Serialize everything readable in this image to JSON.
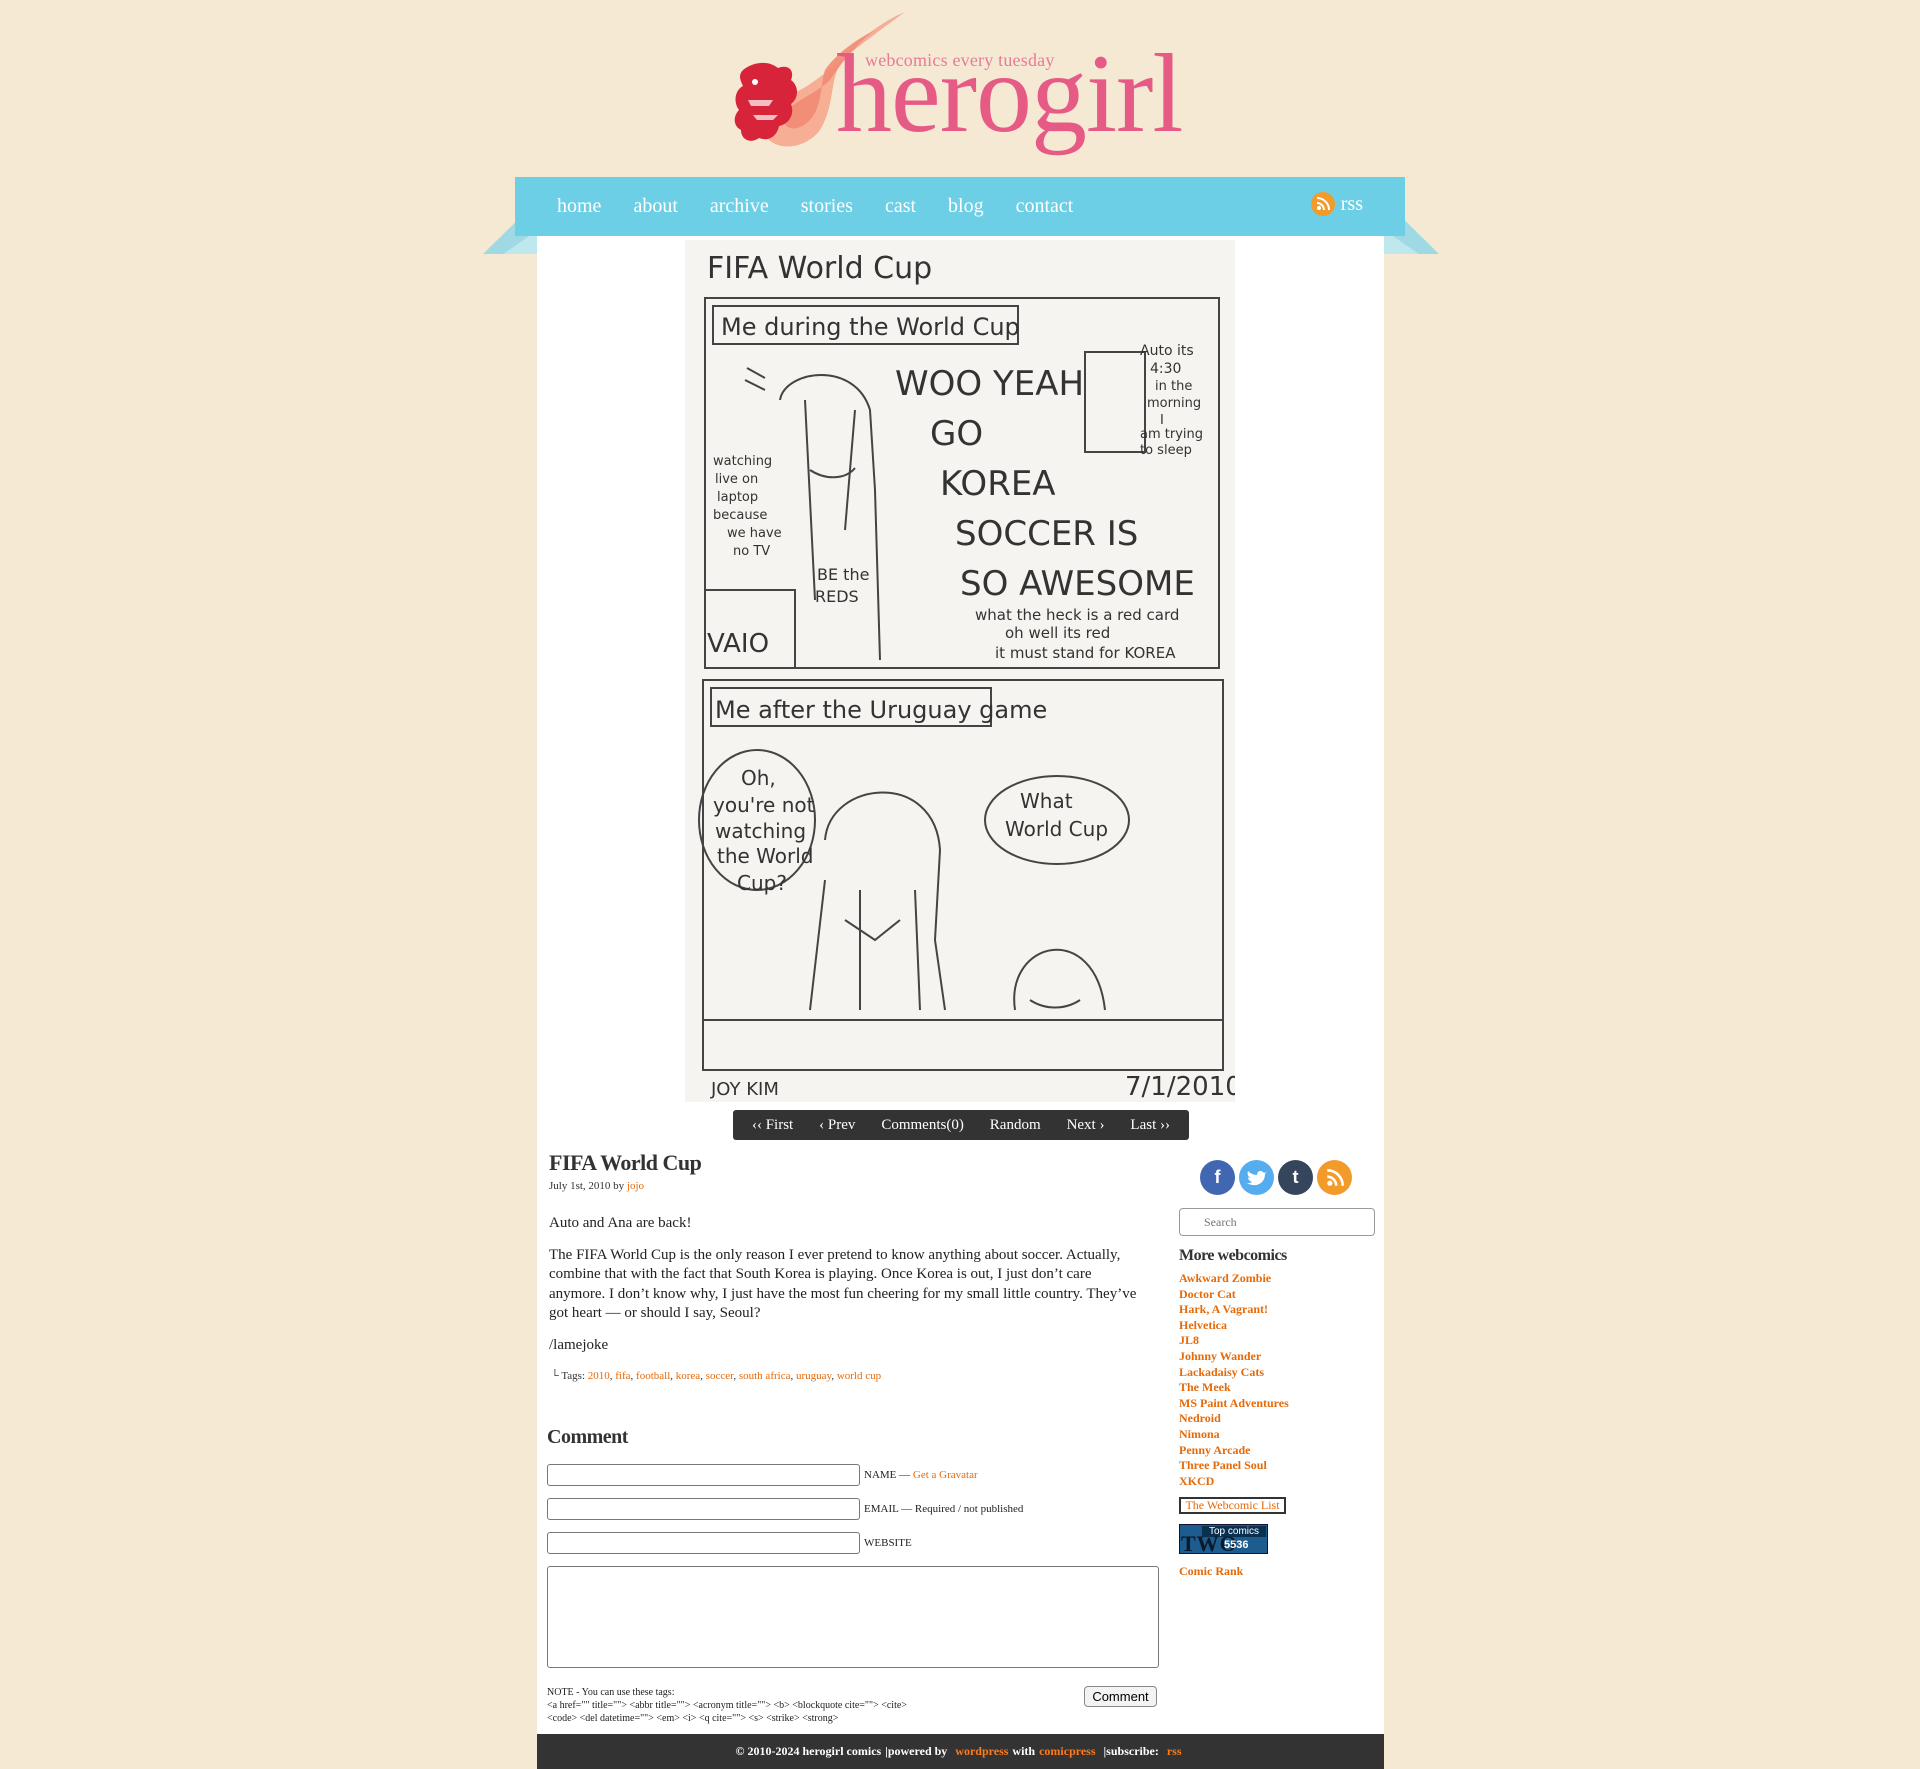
{
  "site": {
    "tagline": "webcomics every tuesday",
    "name": "herogirl",
    "brand_pink": "#e65a86",
    "nav_blue": "#6ccfe6"
  },
  "nav": {
    "items": [
      "home",
      "about",
      "archive",
      "stories",
      "cast",
      "blog",
      "contact"
    ],
    "rss_label": "rss"
  },
  "comic_nav": {
    "first": "‹‹ First",
    "prev": "‹ Prev",
    "comments": "Comments(0)",
    "random": "Random",
    "next": "Next ›",
    "last": "Last ››"
  },
  "post": {
    "title": "FIFA World Cup",
    "date": "July 1st, 2010 by",
    "author": "jojo",
    "paragraphs": [
      "Auto and Ana are back!",
      "The FIFA World Cup is the only reason I ever pretend to know anything about soccer. Actually, combine that with the fact that South Korea is playing. Once Korea is out, I just don’t care anymore. I don’t know why, I just have the most fun cheering for my small little country. They’ve got heart — or should I say, Seoul?",
      "/lamejoke"
    ],
    "tags_label": "└ Tags:",
    "tags": [
      "2010",
      "fifa",
      "football",
      "korea",
      "soccer",
      "south africa",
      "uruguay",
      "world cup"
    ]
  },
  "comment_form": {
    "heading": "Comment",
    "name_label": "NAME —",
    "gravatar_link": "Get a Gravatar",
    "email_label": "EMAIL — Required / not published",
    "website_label": "WEBSITE",
    "submit_label": "Comment",
    "note_line1": "NOTE - You can use these tags:",
    "note_line2": "<a href=\"\" title=\"\"> <abbr title=\"\"> <acronym title=\"\"> <b> <blockquote cite=\"\"> <cite>",
    "note_line3": "<code> <del datetime=\"\"> <em> <i> <q cite=\"\"> <s> <strike> <strong>"
  },
  "sidebar": {
    "social_icons": [
      "facebook-icon",
      "twitter-icon",
      "tumblr-icon",
      "rss-icon"
    ],
    "search_placeholder": "Search",
    "more_title": "More webcomics",
    "links": [
      "Awkward Zombie",
      "Doctor Cat",
      "Hark, A Vagrant!",
      "Helvetica",
      "JL8",
      "Johnny Wander",
      "Lackadaisy Cats",
      "The Meek",
      "MS Paint Adventures",
      "Nedroid",
      "Nimona",
      "Penny Arcade",
      "Three Panel Soul",
      "XKCD"
    ],
    "webcomic_list": "The Webcomic List",
    "topcomics_top": "Top comics",
    "topcomics_two": "TWO",
    "topcomics_num": "5536",
    "comic_rank": "Comic Rank"
  },
  "comic_text": {
    "title": "FIFA World Cup",
    "panel1_caption": "Me during the World Cup",
    "shout1": "WOO YEAH",
    "shout2": "GO",
    "shout3": "KOREA",
    "shout4": "SOCCER IS",
    "shout5": "SO AWESOME",
    "redcard1": "what the heck is a red card",
    "redcard2": "oh well  its red",
    "redcard3": "it must stand for KOREA",
    "door1": "Auto its",
    "door2": "4:30",
    "door3": "in the",
    "door4": "morning",
    "door5": "I",
    "door6": "am trying",
    "door7": "to sleep",
    "side1": "watching",
    "side2": "live on",
    "side3": "laptop",
    "side4": "because",
    "side5": "we have",
    "side6": "no TV",
    "shirt1": "BE the",
    "shirt2": "REDS",
    "laptop": "VAIO",
    "panel2_caption": "Me after the Uruguay game",
    "bubble1_1": "Oh,",
    "bubble1_2": "you're not",
    "bubble1_3": "watching",
    "bubble1_4": "the World",
    "bubble1_5": "Cup?",
    "bubble2_1": "What",
    "bubble2_2": "World Cup",
    "signature": "JOY KIM",
    "date": "7/1/2010"
  },
  "footer": {
    "copyright": "© 2010-2024 herogirl comics",
    "powered": "|powered by",
    "wordpress": "wordpress",
    "with": "with",
    "comicpress": "comicpress",
    "subscribe": "|subscribe:",
    "rss": "rss"
  }
}
